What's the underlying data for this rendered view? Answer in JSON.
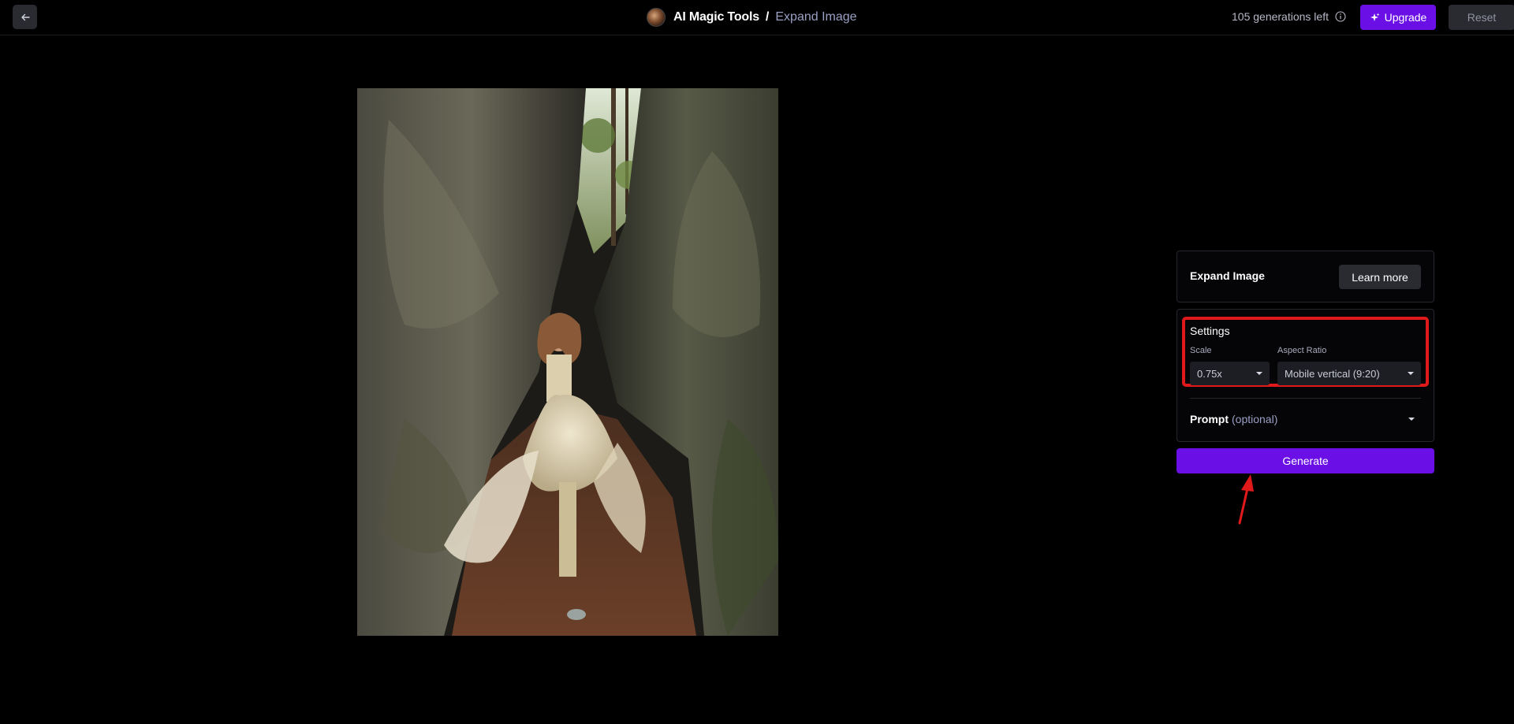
{
  "header": {
    "app_title": "AI Magic Tools",
    "separator": "/",
    "page_name": "Expand Image",
    "generations_left": "105 generations left",
    "upgrade_label": "Upgrade",
    "reset_label": "Reset"
  },
  "panel": {
    "title": "Expand Image",
    "learn_more_label": "Learn more",
    "settings": {
      "title": "Settings",
      "scale_label": "Scale",
      "scale_value": "0.75x",
      "aspect_label": "Aspect Ratio",
      "aspect_value": "Mobile vertical (9:20)"
    },
    "prompt": {
      "label": "Prompt",
      "optional": "(optional)"
    },
    "generate_label": "Generate"
  },
  "colors": {
    "accent": "#6a10e6",
    "annotation": "#e0191b",
    "background": "#000000"
  },
  "icons": {
    "back": "arrow-left-icon",
    "info": "info-icon",
    "upgrade": "sparkle-icon",
    "dropdown": "caret-down-icon"
  }
}
